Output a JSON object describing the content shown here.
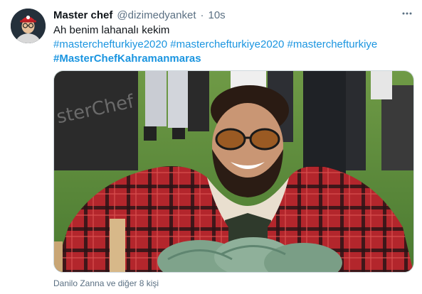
{
  "tweet": {
    "author_name": "Master chef",
    "handle": "@dizimedyanket",
    "separator": "·",
    "time": "10s",
    "more_icon": "more-horizontal-icon",
    "text_line1": "Ah benim lahanalı kekim",
    "hashtags_line2": [
      "#masterchefturkiye2020",
      "#masterchefturkiye2020",
      "#masterchefturkiye"
    ],
    "hashtag_line3": "#MasterChefKahramanmaras",
    "media_background_text": "sterChef",
    "liked_by": "Danilo Zanna ve diğer 8 kişi"
  },
  "colors": {
    "link": "#1b95e0",
    "secondary_text": "#5b7083"
  }
}
